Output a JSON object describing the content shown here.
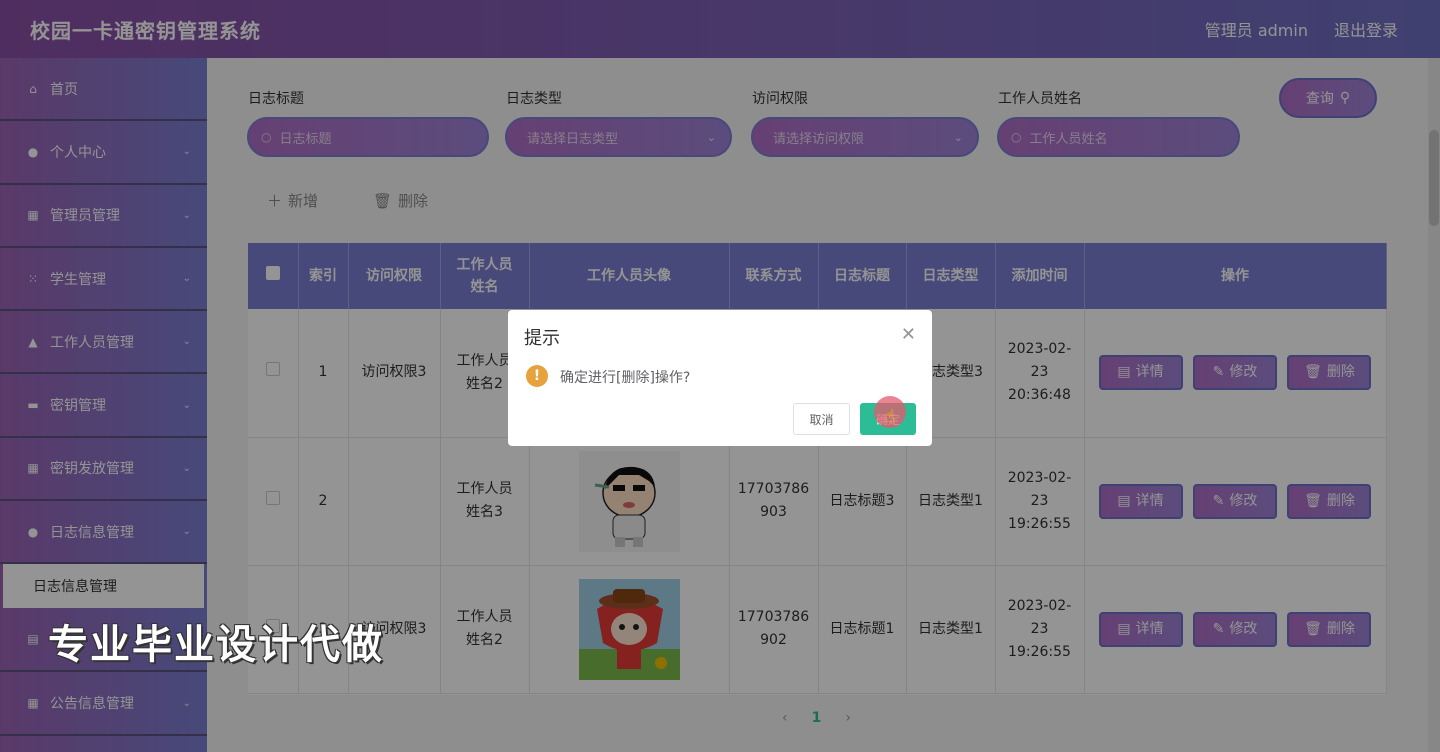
{
  "header": {
    "title": "校园一卡通密钥管理系统",
    "user": "管理员 admin",
    "logout": "退出登录"
  },
  "sidebar": {
    "items": [
      {
        "icon": "home-icon",
        "label": "首页",
        "chev": ""
      },
      {
        "icon": "user-icon",
        "label": "个人中心",
        "chev": "⌄"
      },
      {
        "icon": "grid-icon",
        "label": "管理员管理",
        "chev": "⌄"
      },
      {
        "icon": "apps-icon",
        "label": "学生管理",
        "chev": "⌄"
      },
      {
        "icon": "staff-icon",
        "label": "工作人员管理",
        "chev": "⌄"
      },
      {
        "icon": "key-icon",
        "label": "密钥管理",
        "chev": "⌄"
      },
      {
        "icon": "key-icon",
        "label": "密钥发放管理",
        "chev": "⌄"
      },
      {
        "icon": "user-icon",
        "label": "日志信息管理",
        "chev": "⌄"
      }
    ],
    "submenu_active": "日志信息管理",
    "bottom_item": {
      "icon": "grid-icon",
      "label": "公告信息管理",
      "chev": "⌄"
    }
  },
  "filters": {
    "log_title": {
      "label": "日志标题",
      "placeholder": "日志标题"
    },
    "log_type": {
      "label": "日志类型",
      "placeholder": "请选择日志类型"
    },
    "access": {
      "label": "访问权限",
      "placeholder": "请选择访问权限"
    },
    "staff_name": {
      "label": "工作人员姓名",
      "placeholder": "工作人员姓名"
    },
    "search_label": "查询"
  },
  "actions": {
    "add": "新增",
    "delete": "删除"
  },
  "table": {
    "headers": [
      "索引",
      "访问权限",
      "工作人员姓名",
      "工作人员头像",
      "联系方式",
      "日志标题",
      "日志类型",
      "添加时间",
      "操作"
    ],
    "rows": [
      {
        "index": "1",
        "access": "访问权限3",
        "name": "工作人员姓名2",
        "phone": "",
        "title": "",
        "type": "日志类型3",
        "time": "2023-02-23 20:36:48"
      },
      {
        "index": "2",
        "access": "",
        "name": "工作人员姓名3",
        "phone": "17703786903",
        "title": "日志标题3",
        "type": "日志类型1",
        "time": "2023-02-23 19:26:55"
      },
      {
        "index": "3",
        "access": "访问权限3",
        "name": "工作人员姓名2",
        "phone": "17703786902",
        "title": "日志标题1",
        "type": "日志类型1",
        "time": "2023-02-23 19:26:55"
      }
    ],
    "op_detail": "详情",
    "op_edit": "修改",
    "op_delete": "删除"
  },
  "pager": {
    "prev": "‹",
    "current": "1",
    "next": "›"
  },
  "dialog": {
    "title": "提示",
    "message": "确定进行[删除]操作?",
    "cancel": "取消",
    "confirm": "确定"
  },
  "watermark": "专业毕业设计代做",
  "colors": {
    "accent": "#7a7fd2",
    "confirm": "#2dbd96",
    "warning": "#e6a23c"
  }
}
